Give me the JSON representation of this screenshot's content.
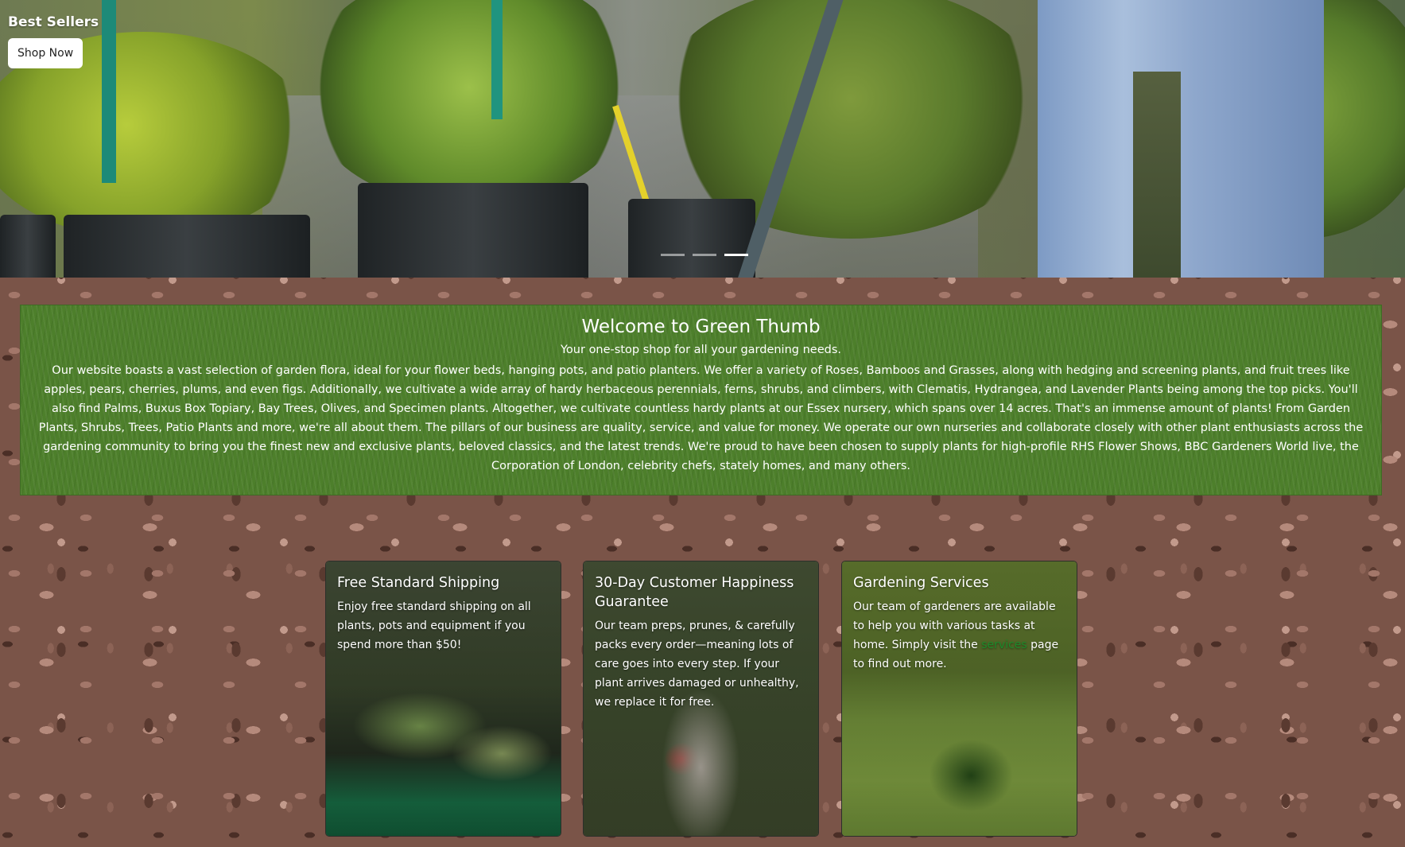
{
  "hero": {
    "title": "Best Sellers",
    "button_label": "Shop Now",
    "slide_count": 3,
    "active_slide": 3
  },
  "welcome": {
    "title": "Welcome to Green Thumb",
    "subtitle": "Your one-stop shop for all your gardening needs.",
    "body": "Our website boasts a vast selection of garden flora, ideal for your flower beds, hanging pots, and patio planters. We offer a variety of Roses, Bamboos and Grasses, along with hedging and screening plants, and fruit trees like apples, pears, cherries, plums, and even figs. Additionally, we cultivate a wide array of hardy herbaceous perennials, ferns, shrubs, and climbers, with Clematis, Hydrangea, and Lavender Plants being among the top picks. You'll also find Palms, Buxus Box Topiary, Bay Trees, Olives, and Specimen plants. Altogether, we cultivate countless hardy plants at our Essex nursery, which spans over 14 acres. That's an immense amount of plants! From Garden Plants, Shrubs, Trees, Patio Plants and more, we're all about them. The pillars of our business are quality, service, and value for money. We operate our own nurseries and collaborate closely with other plant enthusiasts across the gardening community to bring you the finest new and exclusive plants, beloved classics, and the latest trends. We're proud to have been chosen to supply plants for high-profile RHS Flower Shows, BBC Gardeners World live, the Corporation of London, celebrity chefs, stately homes, and many others."
  },
  "cards": [
    {
      "title": "Free Standard Shipping",
      "text": "Enjoy free standard shipping on all plants, pots and equipment if you spend more than $50!"
    },
    {
      "title": "30-Day Customer Happiness Guarantee",
      "text": "Our team preps, prunes, & carefully packs every order—meaning lots of care goes into every step. If your plant arrives damaged or unhealthy, we replace it for free."
    },
    {
      "title": "Gardening Services",
      "text_before": "Our team of gardeners are available to help you with various tasks at home. Simply visit the ",
      "link_label": "services",
      "text_after": " page to find out more."
    }
  ],
  "colors": {
    "welcome_bg": "#4d7f2b",
    "link": "#1e8a2a",
    "text_light": "#ffffff"
  }
}
